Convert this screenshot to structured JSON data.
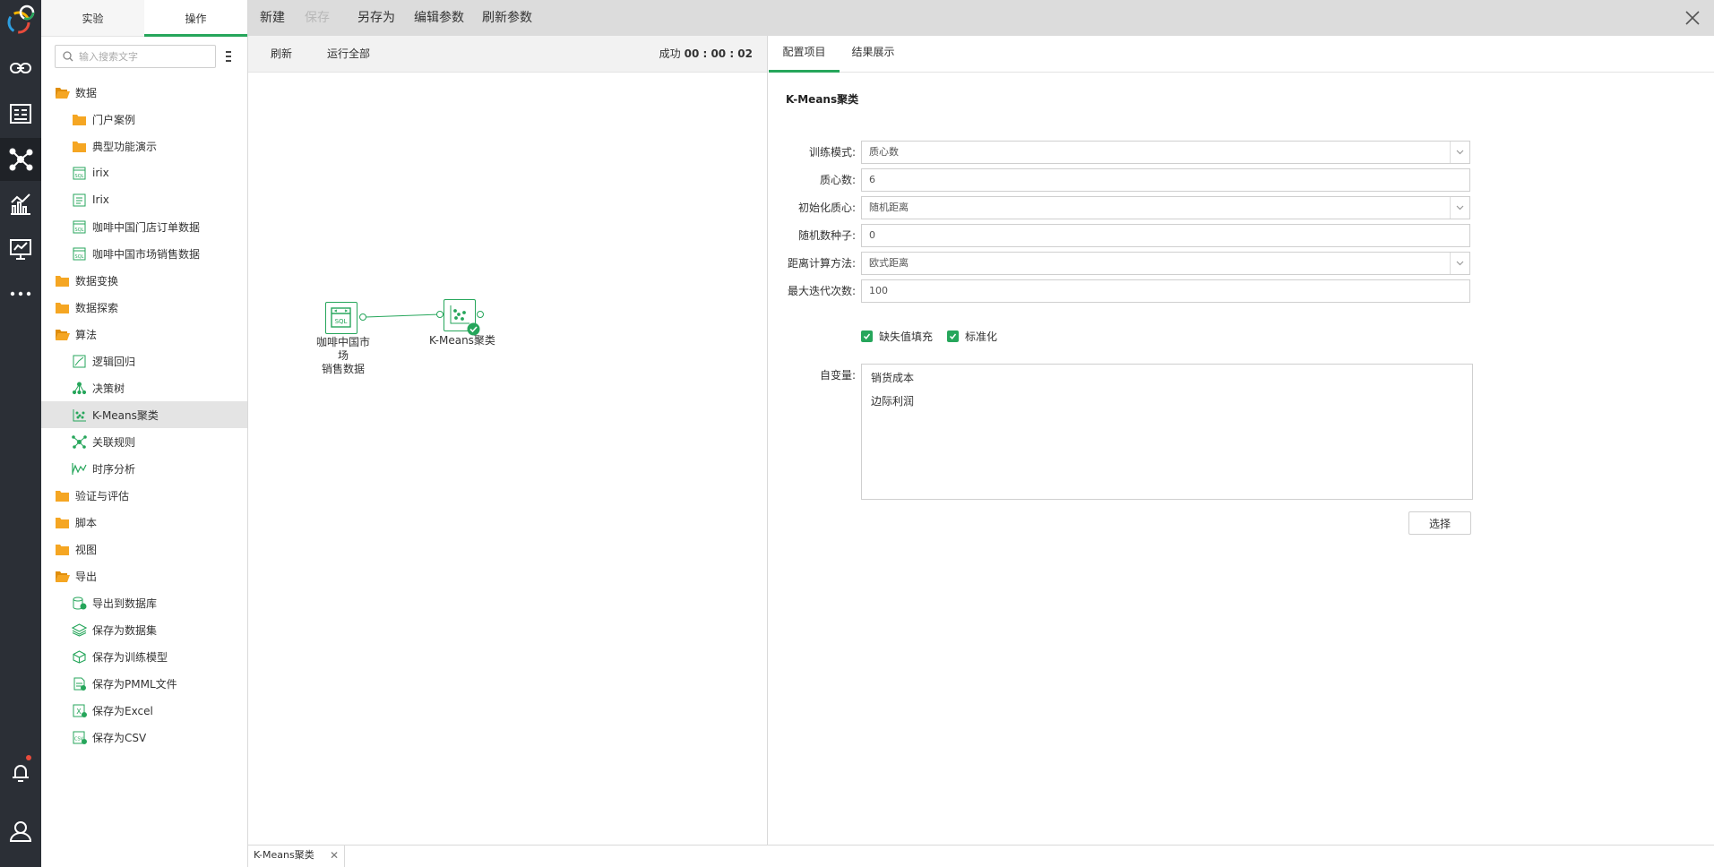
{
  "tree_tabs": [
    "实验",
    "操作"
  ],
  "search": {
    "placeholder": "输入搜索文字"
  },
  "tree": [
    {
      "label": "数据",
      "level": 0,
      "icon": "folder-open-icon"
    },
    {
      "label": "门户案例",
      "level": 1,
      "icon": "folder-icon"
    },
    {
      "label": "典型功能演示",
      "level": 1,
      "icon": "folder-icon"
    },
    {
      "label": "irix",
      "level": 1,
      "icon": "sql-dataset-icon"
    },
    {
      "label": "Irix",
      "level": 1,
      "icon": "dataset-icon"
    },
    {
      "label": "咖啡中国门店订单数据",
      "level": 1,
      "icon": "sql-dataset-icon"
    },
    {
      "label": "咖啡中国市场销售数据",
      "level": 1,
      "icon": "sql-dataset-icon"
    },
    {
      "label": "数据变换",
      "level": 0,
      "icon": "folder-icon"
    },
    {
      "label": "数据探索",
      "level": 0,
      "icon": "folder-icon"
    },
    {
      "label": "算法",
      "level": 0,
      "icon": "folder-open-icon"
    },
    {
      "label": "逻辑回归",
      "level": 1,
      "icon": "regression-icon"
    },
    {
      "label": "决策树",
      "level": 1,
      "icon": "decision-tree-icon"
    },
    {
      "label": "K-Means聚类",
      "level": 1,
      "icon": "scatter-icon",
      "selected": true
    },
    {
      "label": "关联规则",
      "level": 1,
      "icon": "association-icon"
    },
    {
      "label": "时序分析",
      "level": 1,
      "icon": "timeseries-icon"
    },
    {
      "label": "验证与评估",
      "level": 0,
      "icon": "folder-icon"
    },
    {
      "label": "脚本",
      "level": 0,
      "icon": "folder-icon"
    },
    {
      "label": "视图",
      "level": 0,
      "icon": "folder-icon"
    },
    {
      "label": "导出",
      "level": 0,
      "icon": "folder-open-icon"
    },
    {
      "label": "导出到数据库",
      "level": 1,
      "icon": "database-export-icon"
    },
    {
      "label": "保存为数据集",
      "level": 1,
      "icon": "layers-icon"
    },
    {
      "label": "保存为训练模型",
      "level": 1,
      "icon": "cube-icon"
    },
    {
      "label": "保存为PMML文件",
      "level": 1,
      "icon": "pmml-file-icon"
    },
    {
      "label": "保存为Excel",
      "level": 1,
      "icon": "excel-export-icon"
    },
    {
      "label": "保存为CSV",
      "level": 1,
      "icon": "csv-export-icon"
    }
  ],
  "toolbar": {
    "new": "新建",
    "save": "保存",
    "save_as": "另存为",
    "edit_params": "编辑参数",
    "refresh_params": "刷新参数"
  },
  "canvas_toolbar": {
    "refresh": "刷新",
    "run_all": "运行全部",
    "status": "成功",
    "elapsed": "00 : 00 : 02"
  },
  "nodes": {
    "source": {
      "line1": "咖啡中国市场",
      "line2": "销售数据"
    },
    "kmeans": {
      "label": "K-Means聚类"
    }
  },
  "config_tabs": [
    "配置项目",
    "结果展示"
  ],
  "config": {
    "title": "K-Means聚类",
    "fields": [
      {
        "label": "训练模式:",
        "value": "质心数",
        "dropdown": true
      },
      {
        "label": "质心数:",
        "value": "6",
        "dropdown": false
      },
      {
        "label": "初始化质心:",
        "value": "随机距离",
        "dropdown": true
      },
      {
        "label": "随机数种子:",
        "value": "0",
        "dropdown": false
      },
      {
        "label": "距离计算方法:",
        "value": "欧式距离",
        "dropdown": true
      },
      {
        "label": "最大迭代次数:",
        "value": "100",
        "dropdown": false
      }
    ],
    "checkboxes": [
      {
        "label": "缺失值填充",
        "checked": true
      },
      {
        "label": "标准化",
        "checked": true
      }
    ],
    "variables_label": "自变量:",
    "variables": [
      "销货成本",
      "边际利润"
    ],
    "select_button": "选择"
  },
  "bottom_tab": {
    "label": "K-Means聚类"
  },
  "colors": {
    "accent": "#26a65b",
    "rail": "#2b2f36",
    "toolbar": "#dcdcdc"
  }
}
